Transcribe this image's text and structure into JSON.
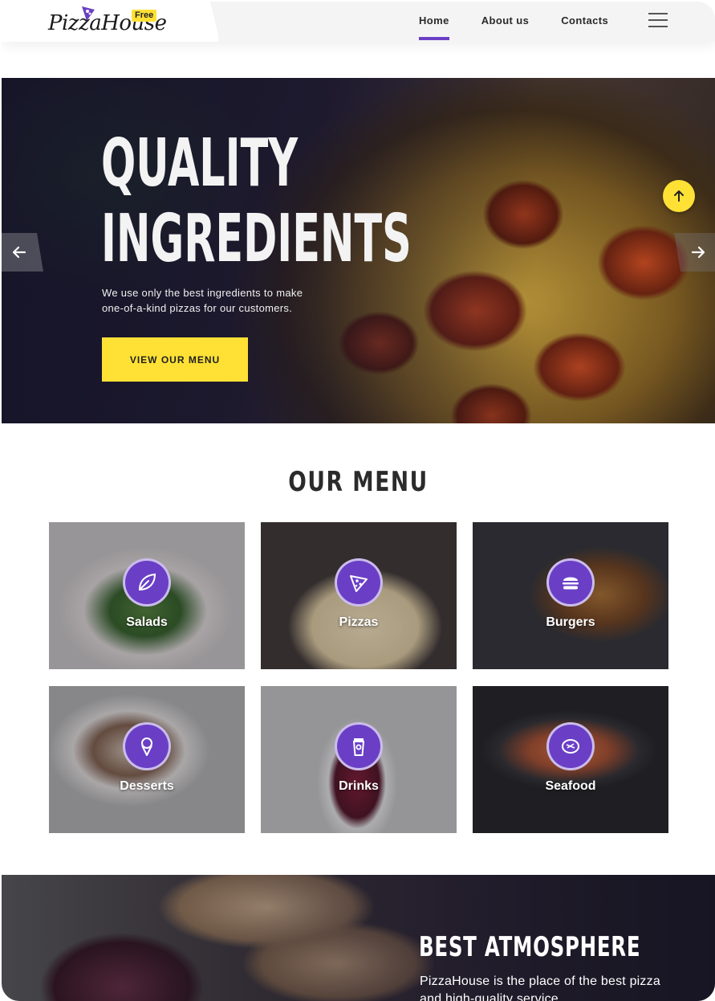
{
  "header": {
    "logo_text": "PizzaHouse",
    "logo_badge": "Free",
    "nav": [
      {
        "label": "Home",
        "active": true
      },
      {
        "label": "About us",
        "active": false
      },
      {
        "label": "Contacts",
        "active": false
      }
    ],
    "menu_icon": "hamburger-icon"
  },
  "hero": {
    "title_line1": "QUALITY",
    "title_line2": "INGREDIENTS",
    "description": "We use only the best ingredients to make one-of-a-kind pizzas for our customers.",
    "button_label": "VIEW OUR MENU",
    "prev_icon": "arrow-left-icon",
    "next_icon": "arrow-right-icon",
    "scroll_top_icon": "arrow-up-icon"
  },
  "menu": {
    "title": "OUR MENU",
    "items": [
      {
        "label": "Salads",
        "icon": "leaf-icon"
      },
      {
        "label": "Pizzas",
        "icon": "pizza-slice-icon"
      },
      {
        "label": "Burgers",
        "icon": "burger-icon"
      },
      {
        "label": "Desserts",
        "icon": "ice-cream-icon"
      },
      {
        "label": "Drinks",
        "icon": "cup-icon"
      },
      {
        "label": "Seafood",
        "icon": "steak-icon"
      }
    ]
  },
  "atmosphere": {
    "title": "BEST ATMOSPHERE",
    "text": "PizzaHouse is the place of the best pizza and high-quality service"
  },
  "colors": {
    "accent_purple": "#6a3fc6",
    "accent_yellow": "#ffe135"
  }
}
